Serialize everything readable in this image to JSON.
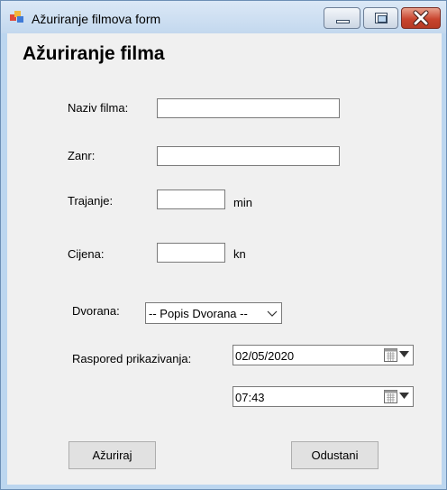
{
  "window": {
    "title": "Ažuriranje filmova form",
    "icon": "winforms-app-icon",
    "controls": {
      "minimize": "minimize-icon",
      "maximize": "maximize-icon",
      "close": "close-icon"
    }
  },
  "form": {
    "heading": "Ažuriranje filma",
    "naziv": {
      "label": "Naziv filma:",
      "value": ""
    },
    "zanr": {
      "label": "Zanr:",
      "value": ""
    },
    "trajanje": {
      "label": "Trajanje:",
      "value": "",
      "unit": "min"
    },
    "cijena": {
      "label": "Cijena:",
      "value": "",
      "unit": "kn"
    },
    "dvorana": {
      "label": "Dvorana:",
      "selected": "-- Popis Dvorana --"
    },
    "raspored": {
      "label": "Raspored prikazivanja:",
      "date": "02/05/2020",
      "time": "07:43"
    }
  },
  "buttons": {
    "azuriraj": "Ažuriraj",
    "odustani": "Odustani"
  },
  "colors": {
    "frame": "#bcd6ef",
    "client_background": "#f0f0f0",
    "close_button": "#c9452f"
  }
}
